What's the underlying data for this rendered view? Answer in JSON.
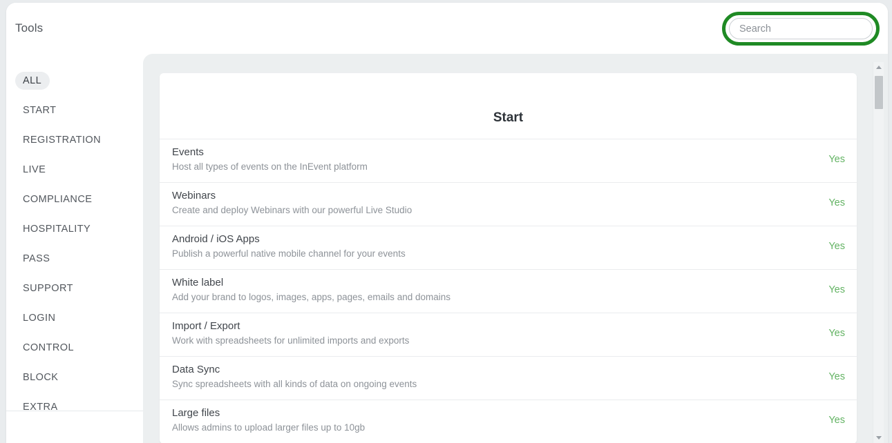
{
  "header": {
    "title": "Tools",
    "search": {
      "placeholder": "Search",
      "value": "",
      "highlight_color": "#1f8a24"
    }
  },
  "sidebar": {
    "items": [
      {
        "label": "ALL",
        "active": true
      },
      {
        "label": "START",
        "active": false
      },
      {
        "label": "REGISTRATION",
        "active": false
      },
      {
        "label": "LIVE",
        "active": false
      },
      {
        "label": "COMPLIANCE",
        "active": false
      },
      {
        "label": "HOSPITALITY",
        "active": false
      },
      {
        "label": "PASS",
        "active": false
      },
      {
        "label": "SUPPORT",
        "active": false
      },
      {
        "label": "LOGIN",
        "active": false
      },
      {
        "label": "CONTROL",
        "active": false
      },
      {
        "label": "BLOCK",
        "active": false
      },
      {
        "label": "EXTRA",
        "active": false
      }
    ]
  },
  "main": {
    "card_title": "Start",
    "rows": [
      {
        "title": "Events",
        "description": "Host all types of events on the InEvent platform",
        "value": "Yes"
      },
      {
        "title": "Webinars",
        "description": "Create and deploy Webinars with our powerful Live Studio",
        "value": "Yes"
      },
      {
        "title": "Android / iOS Apps",
        "description": "Publish a powerful native mobile channel for your events",
        "value": "Yes"
      },
      {
        "title": "White label",
        "description": "Add your brand to logos, images, apps, pages, emails and domains",
        "value": "Yes"
      },
      {
        "title": "Import / Export",
        "description": "Work with spreadsheets for unlimited imports and exports",
        "value": "Yes"
      },
      {
        "title": "Data Sync",
        "description": "Sync spreadsheets with all kinds of data on ongoing events",
        "value": "Yes"
      },
      {
        "title": "Large files",
        "description": "Allows admins to upload larger files up to 10gb",
        "value": "Yes"
      }
    ]
  },
  "scrollbar": {
    "up_arrow": "chevron-up",
    "down_arrow": "chevron-down"
  },
  "colors": {
    "value_green": "#63b363",
    "highlight_green": "#1f8a24",
    "panel_bg": "#eceff0"
  }
}
